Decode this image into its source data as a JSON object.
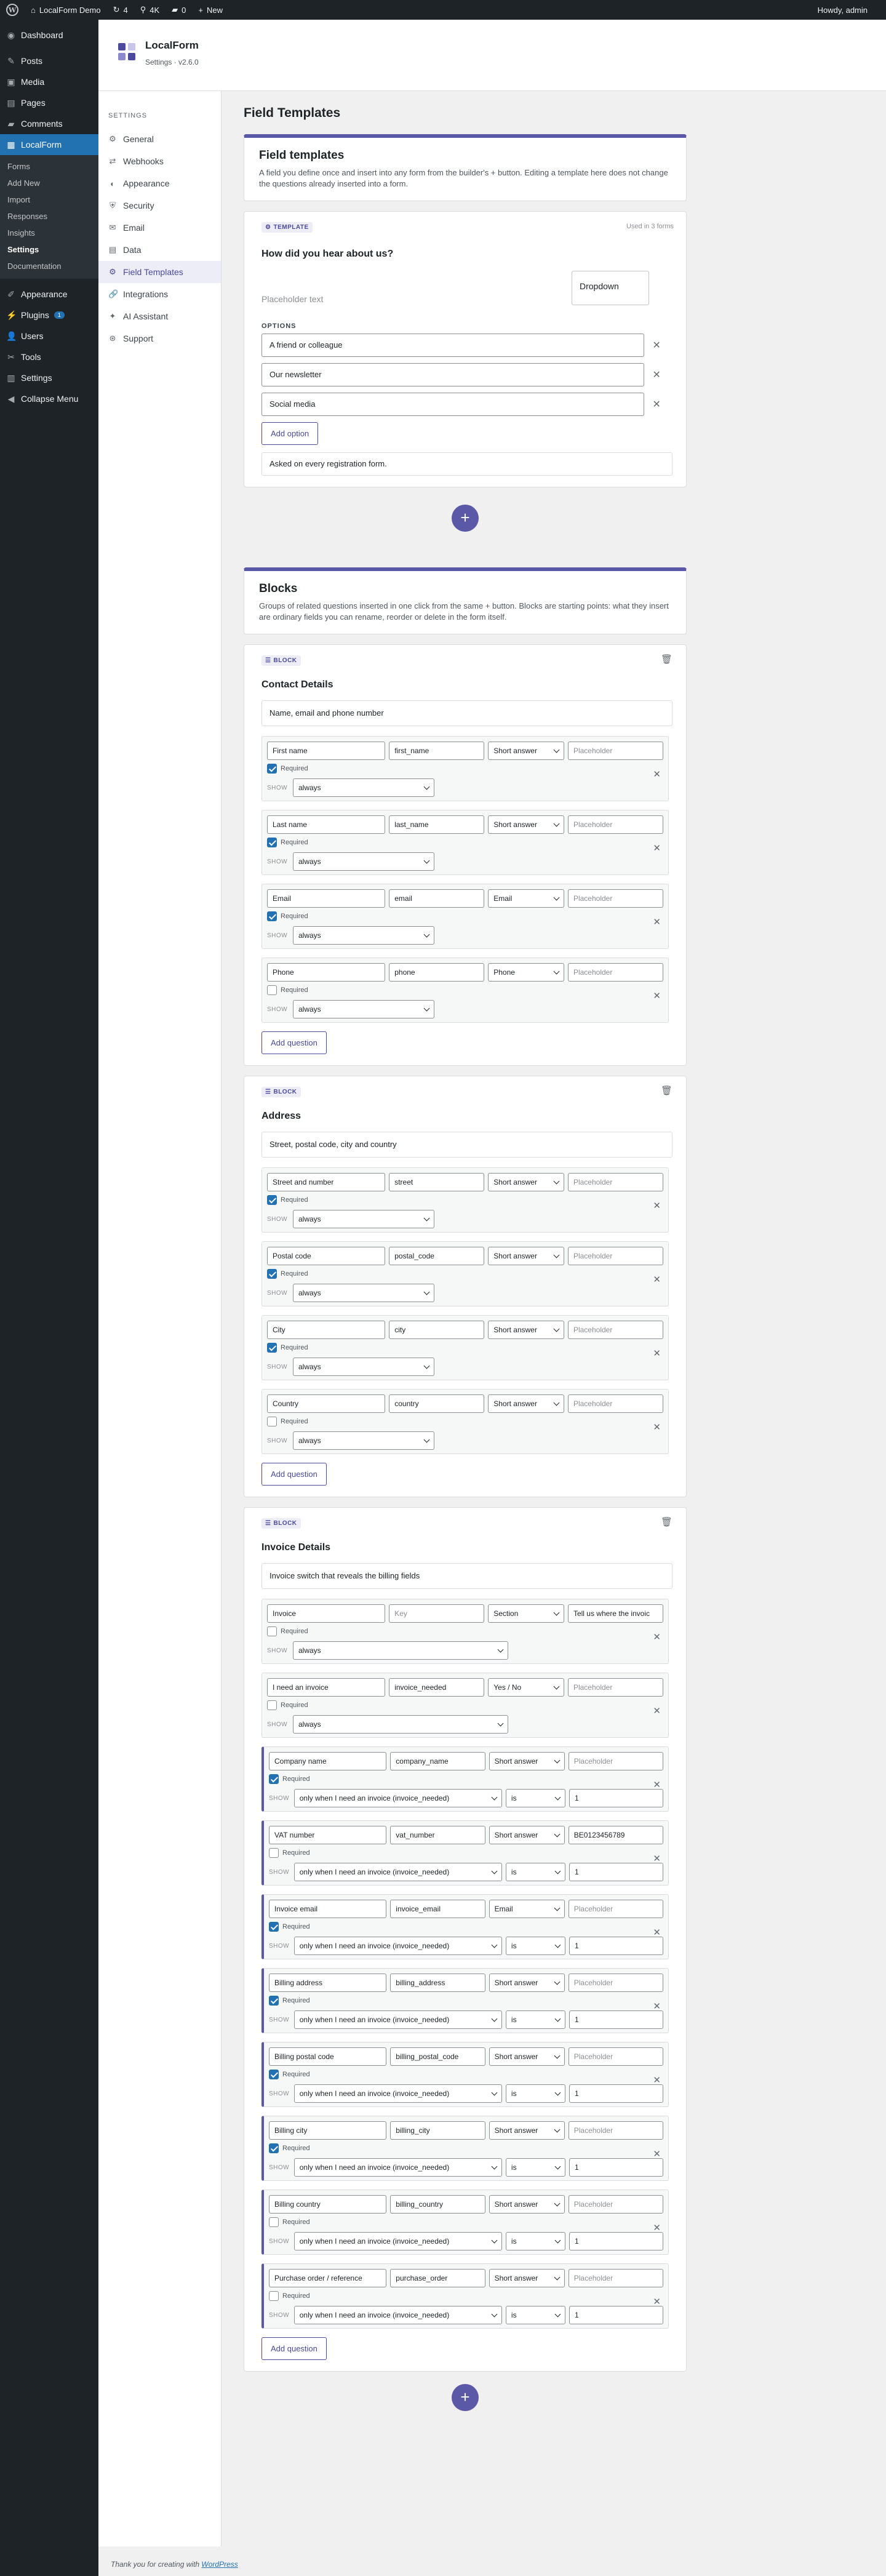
{
  "adminbar": {
    "site": "LocalForm Demo",
    "updates": "4",
    "search_count": "4K",
    "comments": "0",
    "new": "New",
    "howdy": "Howdy, admin"
  },
  "menu": {
    "dashboard": "Dashboard",
    "posts": "Posts",
    "media": "Media",
    "pages": "Pages",
    "comments": "Comments",
    "localform": "LocalForm",
    "sub": [
      "Forms",
      "Add New",
      "Import",
      "Responses",
      "Insights",
      "Settings",
      "Documentation"
    ],
    "appearance": "Appearance",
    "plugins": "Plugins",
    "plugins_badge": "1",
    "users": "Users",
    "tools": "Tools",
    "settings": "Settings",
    "collapse": "Collapse Menu"
  },
  "header": {
    "title": "LocalForm",
    "version": "Settings · v2.6.0"
  },
  "sidenav": {
    "heading": "SETTINGS",
    "items": [
      "General",
      "Webhooks",
      "Appearance",
      "Security",
      "Email",
      "Data",
      "Field Templates",
      "Integrations",
      "AI Assistant",
      "Support"
    ]
  },
  "page_title": "Field Templates",
  "field_templates": {
    "title": "Field templates",
    "desc": "A field you define once and insert into any form from the builder's + button. Editing a template here does not change the questions already inserted into a form."
  },
  "template": {
    "tag": "TEMPLATE",
    "used_in": "Used in 3 forms",
    "question": "How did you hear about us?",
    "type": "Dropdown",
    "placeholder": "Placeholder text",
    "options_label": "OPTIONS",
    "options": [
      "A friend or colleague",
      "Our newsletter",
      "Social media"
    ],
    "add_option": "Add option",
    "note": "Asked on every registration form."
  },
  "blocks_intro": {
    "title": "Blocks",
    "desc": "Groups of related questions inserted in one click from the same + button. Blocks are starting points: what they insert are ordinary fields you can rename, reorder or delete in the form itself."
  },
  "labels": {
    "block_tag": "BLOCK",
    "required": "Required",
    "show": "SHOW",
    "add_question": "Add question",
    "placeholder": "Placeholder",
    "key": "Key"
  },
  "blocks": [
    {
      "title": "Contact Details",
      "desc": "Name, email and phone number",
      "questions": [
        {
          "label": "First name",
          "key": "first_name",
          "type": "Short answer",
          "placeholder": "",
          "required": true,
          "show": "always"
        },
        {
          "label": "Last name",
          "key": "last_name",
          "type": "Short answer",
          "placeholder": "",
          "required": true,
          "show": "always"
        },
        {
          "label": "Email",
          "key": "email",
          "type": "Email",
          "placeholder": "",
          "required": true,
          "show": "always"
        },
        {
          "label": "Phone",
          "key": "phone",
          "type": "Phone",
          "placeholder": "",
          "required": false,
          "show": "always"
        }
      ]
    },
    {
      "title": "Address",
      "desc": "Street, postal code, city and country",
      "questions": [
        {
          "label": "Street and number",
          "key": "street",
          "type": "Short answer",
          "placeholder": "",
          "required": true,
          "show": "always"
        },
        {
          "label": "Postal code",
          "key": "postal_code",
          "type": "Short answer",
          "placeholder": "",
          "required": true,
          "show": "always"
        },
        {
          "label": "City",
          "key": "city",
          "type": "Short answer",
          "placeholder": "",
          "required": true,
          "show": "always"
        },
        {
          "label": "Country",
          "key": "country",
          "type": "Short answer",
          "placeholder": "",
          "required": false,
          "show": "always"
        }
      ]
    },
    {
      "title": "Invoice Details",
      "desc": "Invoice switch that reveals the billing fields",
      "questions": [
        {
          "label": "Invoice",
          "key": "",
          "type": "Section",
          "placeholder": "Tell us where the invoic",
          "required": false,
          "show": "always"
        },
        {
          "label": "I need an invoice",
          "key": "invoice_needed",
          "type": "Yes / No",
          "placeholder": "",
          "required": false,
          "show": "always"
        },
        {
          "label": "Company name",
          "key": "company_name",
          "type": "Short answer",
          "placeholder": "",
          "required": true,
          "show": "only when I need an invoice (invoice_needed)",
          "op": "is",
          "val": "1"
        },
        {
          "label": "VAT number",
          "key": "vat_number",
          "type": "Short answer",
          "placeholder": "BE0123456789",
          "required": false,
          "show": "only when I need an invoice (invoice_needed)",
          "op": "is",
          "val": "1"
        },
        {
          "label": "Invoice email",
          "key": "invoice_email",
          "type": "Email",
          "placeholder": "",
          "required": true,
          "show": "only when I need an invoice (invoice_needed)",
          "op": "is",
          "val": "1"
        },
        {
          "label": "Billing address",
          "key": "billing_address",
          "type": "Short answer",
          "placeholder": "",
          "required": true,
          "show": "only when I need an invoice (invoice_needed)",
          "op": "is",
          "val": "1"
        },
        {
          "label": "Billing postal code",
          "key": "billing_postal_code",
          "type": "Short answer",
          "placeholder": "",
          "required": true,
          "show": "only when I need an invoice (invoice_needed)",
          "op": "is",
          "val": "1"
        },
        {
          "label": "Billing city",
          "key": "billing_city",
          "type": "Short answer",
          "placeholder": "",
          "required": true,
          "show": "only when I need an invoice (invoice_needed)",
          "op": "is",
          "val": "1"
        },
        {
          "label": "Billing country",
          "key": "billing_country",
          "type": "Short answer",
          "placeholder": "",
          "required": false,
          "show": "only when I need an invoice (invoice_needed)",
          "op": "is",
          "val": "1"
        },
        {
          "label": "Purchase order / reference",
          "key": "purchase_order",
          "type": "Short answer",
          "placeholder": "",
          "required": false,
          "show": "only when I need an invoice (invoice_needed)",
          "op": "is",
          "val": "1"
        }
      ]
    }
  ],
  "footer": {
    "text": "Thank you for creating with",
    "link": "WordPress"
  },
  "colors": {
    "accent": "#5b58a8",
    "wp_blue": "#2271b1",
    "menu_bg": "#1d2327"
  }
}
